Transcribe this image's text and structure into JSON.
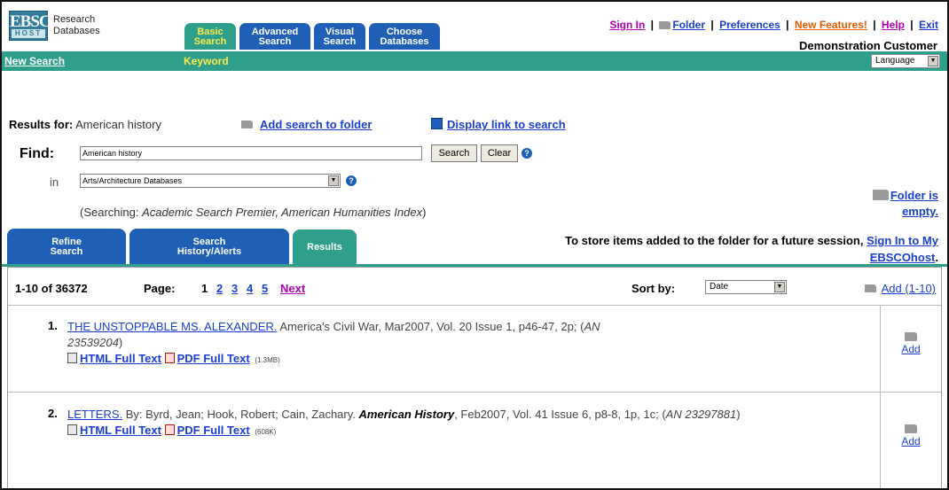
{
  "logo": {
    "brand_top": "EBSCO",
    "brand_bottom": "HOST",
    "line1": "Research",
    "line2": "Databases"
  },
  "top_tabs": [
    {
      "line1": "Basic",
      "line2": "Search",
      "active": true
    },
    {
      "line1": "Advanced",
      "line2": "Search",
      "active": false
    },
    {
      "line1": "Visual",
      "line2": "Search",
      "active": false
    },
    {
      "line1": "Choose",
      "line2": "Databases",
      "active": false
    }
  ],
  "topnav": {
    "sign_in": "Sign In",
    "folder": "Folder",
    "preferences": "Preferences",
    "new_features": "New Features!",
    "help": "Help",
    "exit": "Exit",
    "sep": "|"
  },
  "customer": "Demonstration Customer",
  "greenbar": {
    "new_search": "New Search",
    "keyword": "Keyword",
    "language": "Language"
  },
  "results_for": {
    "label": "Results for:",
    "query": "American history",
    "add_folder": "Add search to folder",
    "display_link": "Display link to search"
  },
  "find": {
    "label": "Find:",
    "value": "American history",
    "search_btn": "Search",
    "clear_btn": "Clear"
  },
  "in_db": {
    "label": "in",
    "value": "Arts/Architecture Databases"
  },
  "searching": {
    "prefix": "(Searching: ",
    "dbs": "Academic Search Premier, American Humanities Index",
    "suffix": ")"
  },
  "folder_status": {
    "line1": "Folder is",
    "line2": "empty."
  },
  "mid_tabs": [
    {
      "line1": "Refine",
      "line2": "Search"
    },
    {
      "line1": "Search",
      "line2": "History/Alerts"
    },
    {
      "line1": "Results",
      "line2": ""
    }
  ],
  "store_msg": {
    "text": "To store items added to the folder for a future session,",
    "link1": "Sign In to My",
    "link2": "EBSCOhost",
    "end": "."
  },
  "pagebar": {
    "count": "1-10 of 36372",
    "page_label": "Page:",
    "pages": [
      "1",
      "2",
      "3",
      "4",
      "5"
    ],
    "next": "Next",
    "sort_label": "Sort by:",
    "sort_value": "Date",
    "add_range": "Add (1-10)"
  },
  "results": [
    {
      "num": "1.",
      "title": "THE UNSTOPPABLE MS. ALEXANDER.",
      "citation": "America's Civil War, Mar2007, Vol. 20 Issue 1, p46-47, 2p; (",
      "an_label": "AN",
      "an_value": "23539204",
      "html": "HTML Full Text",
      "pdf": "PDF Full Text",
      "pdf_size": "(1.3MB)",
      "add": "Add"
    },
    {
      "num": "2.",
      "title": "LETTERS.",
      "byline": "By: Byrd, Jean; Hook, Robert; Cain, Zachary.",
      "source": "American History",
      "citation": ", Feb2007, Vol. 41 Issue 6, p8-8, 1p, 1c; (",
      "an_label": "AN",
      "an_value": "23297881",
      "html": "HTML Full Text",
      "pdf": "PDF Full Text",
      "pdf_size": "(608K)",
      "add": "Add"
    }
  ]
}
